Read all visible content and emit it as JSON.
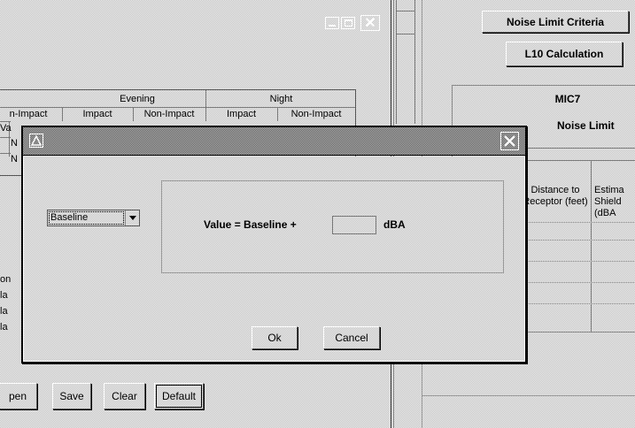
{
  "left_window": {
    "table": {
      "group_headers": [
        "Evening",
        "Night"
      ],
      "column_headers": [
        "n-Impact",
        "Impact",
        "Non-Impact",
        "Impact",
        "Non-Impact"
      ],
      "left_fragments": [
        "Va",
        "N",
        "N"
      ],
      "lower_fragments": [
        "on",
        "la",
        "la",
        "la"
      ]
    },
    "buttons": {
      "open": "pen",
      "save": "Save",
      "clear": "Clear",
      "default": "Default"
    }
  },
  "right_window": {
    "noise_limit_criteria": "Noise Limit Criteria",
    "l10_calculation": "L10 Calculation",
    "station": "MIC7",
    "noise_limit": "Noise Limit",
    "col_distance": "Distance to Receptor (feet)",
    "col_estimate": "Estima Shield (dBA"
  },
  "dialog": {
    "dropdown_value": "Baseline",
    "formula_label": "Value = Baseline +",
    "value_input": "",
    "unit": "dBA",
    "ok_label": "Ok",
    "cancel_label": "Cancel"
  },
  "colors": {
    "face": "#d7d7d7",
    "shadow": "#555555",
    "highlight": "#ffffff"
  }
}
